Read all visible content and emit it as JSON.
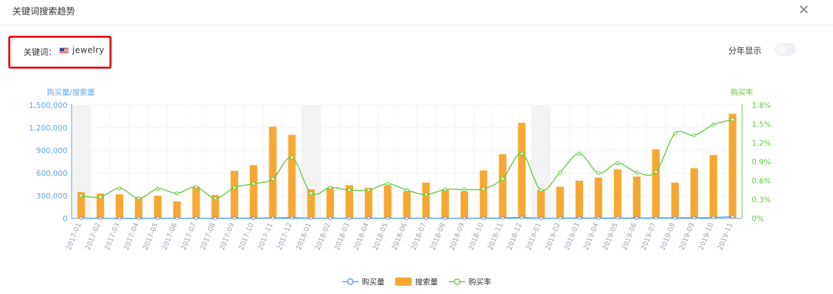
{
  "header": {
    "title": "关键词搜索趋势"
  },
  "keyword": {
    "label": "关键词：",
    "value": "jewelry"
  },
  "year_toggle": {
    "label": "分年显示",
    "state": "off"
  },
  "colors": {
    "bar": "#f7a833",
    "rate_line": "#66cc44",
    "purchase_line": "#5b9ce8",
    "axis_left": "#5ba6e8",
    "axis_right": "#66cc44"
  },
  "chart_data": {
    "type": "bar",
    "categories": [
      "2017-01",
      "2017-02",
      "2017-03",
      "2017-04",
      "2017-05",
      "2017-06",
      "2017-07",
      "2017-08",
      "2017-09",
      "2017-10",
      "2017-11",
      "2017-12",
      "2018-01",
      "2018-02",
      "2018-03",
      "2018-04",
      "2018-05",
      "2018-06",
      "2018-07",
      "2018-08",
      "2018-09",
      "2018-10",
      "2018-11",
      "2018-12",
      "2019-01",
      "2019-02",
      "2019-03",
      "2019-04",
      "2019-05",
      "2019-06",
      "2019-07",
      "2019-08",
      "2019-09",
      "2019-10",
      "2019-11"
    ],
    "series": [
      {
        "name": "购买量",
        "type": "line",
        "axis": "left",
        "values": [
          1200,
          1100,
          1500,
          900,
          1400,
          900,
          2000,
          1000,
          3000,
          3900,
          7000,
          10000,
          1500,
          2000,
          2000,
          1800,
          2400,
          1600,
          1900,
          1700,
          1700,
          3000,
          5500,
          13000,
          1700,
          3100,
          5200,
          3800,
          5800,
          4000,
          6800,
          6500,
          8800,
          12500,
          22000
        ]
      },
      {
        "name": "搜索量",
        "type": "bar",
        "axis": "left",
        "values": [
          350000,
          330000,
          320000,
          270000,
          300000,
          225000,
          420000,
          310000,
          630000,
          705000,
          1215000,
          1105000,
          385000,
          410000,
          440000,
          405000,
          435000,
          360000,
          475000,
          375000,
          360000,
          635000,
          850000,
          1265000,
          380000,
          420000,
          500000,
          540000,
          650000,
          555000,
          915000,
          475000,
          665000,
          840000,
          1385000
        ]
      },
      {
        "name": "购买率",
        "type": "line",
        "axis": "right",
        "unit": "%",
        "values": [
          0.36,
          0.34,
          0.48,
          0.32,
          0.47,
          0.4,
          0.5,
          0.32,
          0.49,
          0.55,
          0.63,
          0.97,
          0.4,
          0.49,
          0.45,
          0.45,
          0.55,
          0.45,
          0.38,
          0.46,
          0.46,
          0.47,
          0.63,
          1.03,
          0.45,
          0.73,
          1.03,
          0.72,
          0.88,
          0.73,
          0.74,
          1.35,
          1.32,
          1.49,
          1.57
        ]
      }
    ],
    "y_left": {
      "label": "购买量/搜索量",
      "ylim": [
        0,
        1500000
      ],
      "ticks": [
        "0",
        "300,000",
        "600,000",
        "900,000",
        "1,200,000",
        "1,500,000"
      ]
    },
    "y_right": {
      "label": "购买率",
      "ylim": [
        0,
        1.8
      ],
      "ticks": [
        "0%",
        "0.3%",
        "0.6%",
        "0.9%",
        "1.2%",
        "1.5%",
        "1.8%"
      ]
    },
    "legend": [
      "购买量",
      "搜索量",
      "购买率"
    ],
    "legend_position": "bottom-center",
    "highlighted_categories": [
      "2017-01",
      "2018-01",
      "2019-01"
    ],
    "grid": true
  }
}
